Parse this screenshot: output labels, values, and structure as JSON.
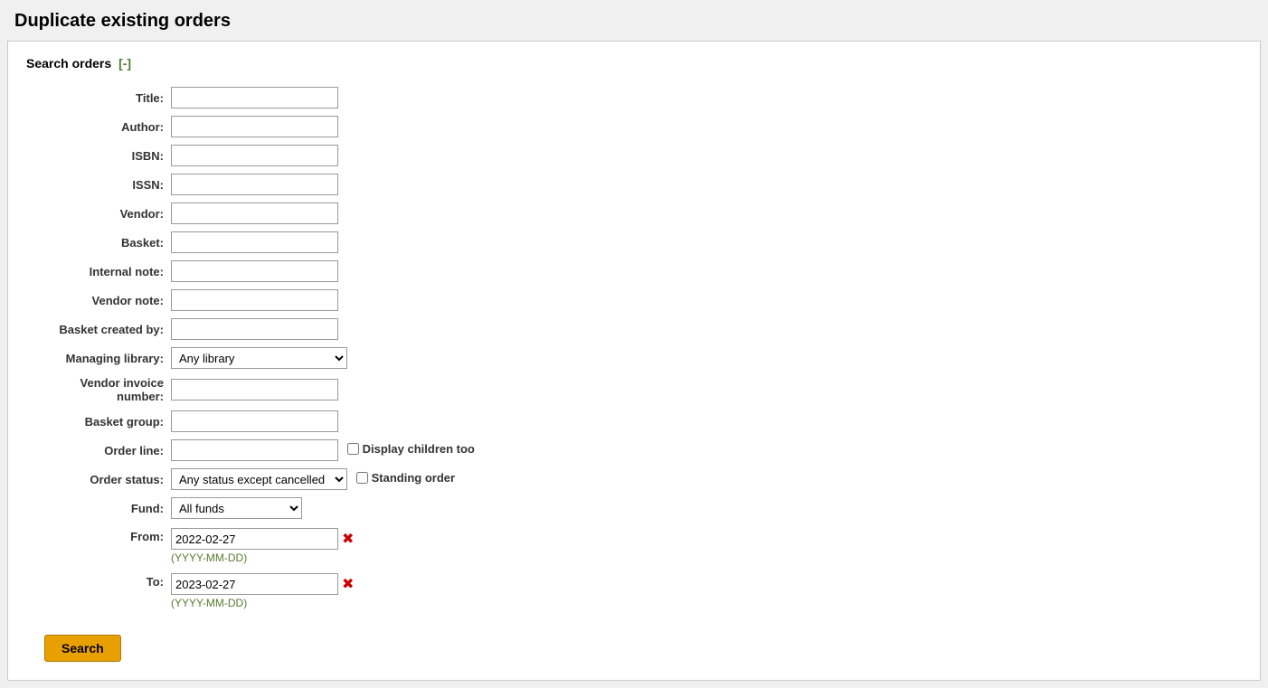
{
  "page": {
    "title": "Duplicate existing orders"
  },
  "search_section": {
    "header": "Search orders",
    "collapse_btn": "[-]"
  },
  "form": {
    "title_label": "Title:",
    "author_label": "Author:",
    "isbn_label": "ISBN:",
    "issn_label": "ISSN:",
    "vendor_label": "Vendor:",
    "basket_label": "Basket:",
    "internal_note_label": "Internal note:",
    "vendor_note_label": "Vendor note:",
    "basket_created_by_label": "Basket created by:",
    "managing_library_label": "Managing library:",
    "vendor_invoice_number_label": "Vendor invoice number:",
    "basket_group_label": "Basket group:",
    "order_line_label": "Order line:",
    "display_children_too_label": "Display children too",
    "order_status_label": "Order status:",
    "standing_order_label": "Standing order",
    "fund_label": "Fund:",
    "from_label": "From:",
    "to_label": "To:",
    "date_hint": "(YYYY-MM-DD)",
    "from_value": "2022-02-27",
    "to_value": "2023-02-27",
    "managing_library_options": [
      {
        "value": "",
        "label": "Any library"
      }
    ],
    "managing_library_selected": "Any library",
    "order_status_options": [
      {
        "value": "any_except_cancelled",
        "label": "Any status except cancelled"
      }
    ],
    "order_status_selected": "Any status except cancelled",
    "fund_options": [
      {
        "value": "all",
        "label": "All funds"
      }
    ],
    "fund_selected": "All funds"
  },
  "buttons": {
    "search": "Search"
  }
}
